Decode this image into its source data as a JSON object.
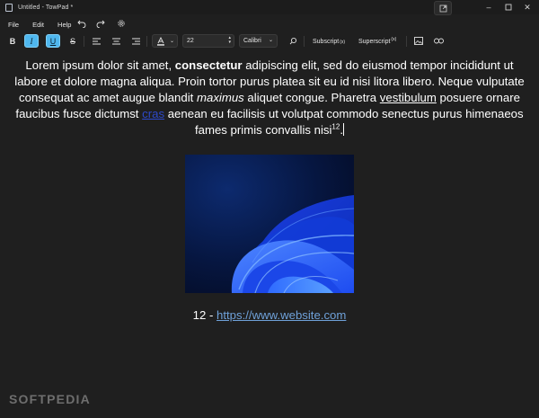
{
  "window": {
    "title": "Untitled - TowPad *"
  },
  "menu": {
    "items": [
      "File",
      "Edit",
      "Help"
    ]
  },
  "toolbar": {
    "bold_label": "B",
    "italic_label": "I",
    "underline_label": "U",
    "strike_label": "S",
    "font_size": "22",
    "font_family": "Calibri",
    "subscript_label": "Subscript",
    "subscript_glyph": "(x)",
    "superscript_label": "Superscript",
    "superscript_glyph": "(x)",
    "active_color": "#4fb7ee"
  },
  "document": {
    "p1": "Lorem ipsum dolor sit amet, ",
    "bold": "consectetur",
    "p2": " adipiscing elit, sed do eiusmod tempor incididunt ut labore et dolore magna aliqua. Proin tortor purus platea sit eu id nisi litora libero. Neque vulputate consequat ac amet augue blandit ",
    "italic": "maximus",
    "p3": " aliquet congue. Pharetra ",
    "underlined": "vestibulum",
    "p4": " posuere ornare faucibus fusce dictumst ",
    "link_word": "cras",
    "p5": " aenean eu facilisis ut volutpat commodo senectus purus himenaeos fames primis convallis nisi",
    "superscript": "12",
    "p6": "."
  },
  "caption": {
    "prefix": "12 - ",
    "url": "https://www.website.com"
  },
  "watermark": {
    "text": "SOFTPEDIA"
  }
}
